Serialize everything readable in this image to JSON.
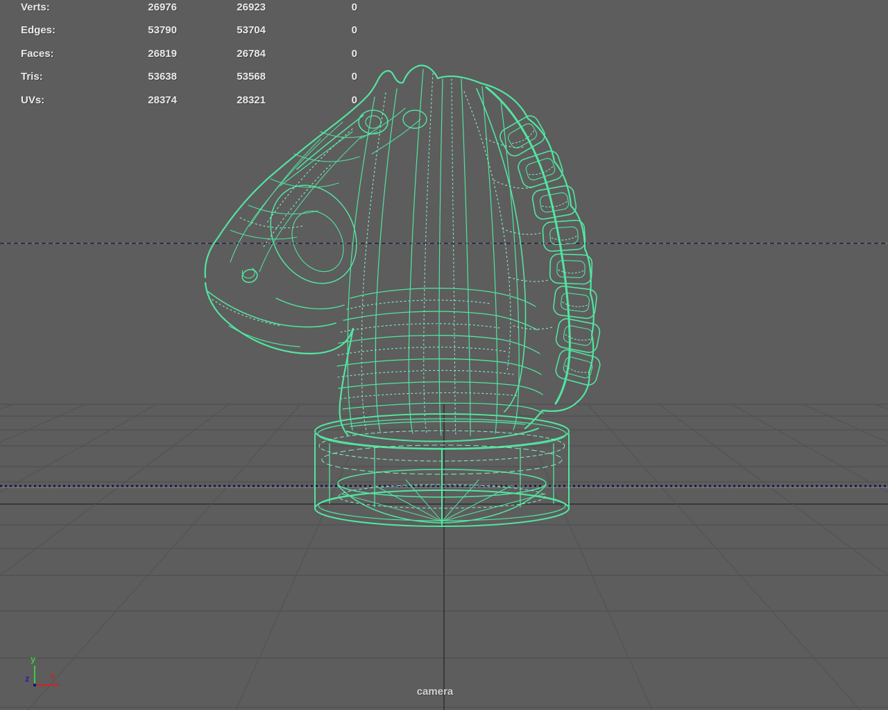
{
  "viewport": {
    "camera_label": "camera",
    "view_type": "perspective-camera-view",
    "model": "chess-knight-wireframe"
  },
  "hud": {
    "rows": [
      {
        "label": "Verts:",
        "col1": "26976",
        "col2": "26923",
        "col3": "0"
      },
      {
        "label": "Edges:",
        "col1": "53790",
        "col2": "53704",
        "col3": "0"
      },
      {
        "label": "Faces:",
        "col1": "26819",
        "col2": "26784",
        "col3": "0"
      },
      {
        "label": "Tris:",
        "col1": "53638",
        "col2": "53568",
        "col3": "0"
      },
      {
        "label": "UVs:",
        "col1": "28374",
        "col2": "28321",
        "col3": "0"
      }
    ]
  },
  "axis_gizmo": {
    "x_label": "x",
    "y_label": "y",
    "z_label": "z",
    "x_color": "#c62828",
    "y_color": "#3ecb3e",
    "z_color": "#23239d"
  },
  "colors": {
    "background": "#5d5d5d",
    "wireframe_green": "#52e5a0",
    "wireframe_light_green": "#8aeec4",
    "grid_line": "#4b4b4b",
    "grid_axis_dark": "#3a3a3a",
    "horizon_dash_navy": "#21213e",
    "hud_text": "#e9e9e9",
    "camera_text": "#cfcfcf"
  }
}
